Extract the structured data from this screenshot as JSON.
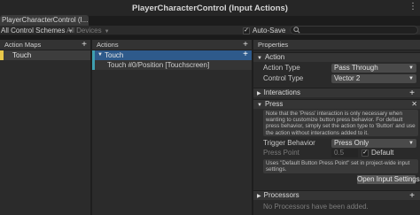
{
  "window": {
    "title": "PlayerCharacterControl (Input Actions)"
  },
  "tab": {
    "label": "PlayerCharacterControl (I..."
  },
  "toolbar": {
    "control_scheme": "All Control Schemes",
    "devices": "All Devices",
    "auto_save_label": "Auto-Save",
    "auto_save_checked": true,
    "search_placeholder": "",
    "search_icon": "search-icon"
  },
  "action_maps": {
    "header": "Action Maps",
    "items": [
      {
        "label": "Touch",
        "selected": true
      }
    ]
  },
  "actions": {
    "header": "Actions",
    "items": [
      {
        "label": "Touch",
        "selected": true,
        "expanded": true,
        "bindings": [
          {
            "label": "Touch #0/Position [Touchscreen]"
          }
        ]
      }
    ]
  },
  "properties": {
    "header": "Properties",
    "action_section": {
      "title": "Action",
      "action_type_label": "Action Type",
      "action_type_value": "Pass Through",
      "control_type_label": "Control Type",
      "control_type_value": "Vector 2"
    },
    "interactions_section": {
      "title": "Interactions"
    },
    "press_section": {
      "title": "Press",
      "note": "Note that the 'Press' interaction is only necessary when wanting to customize button press behavior. For default press behavior, simply set the action type to 'Button' and use the action without interactions added to it.",
      "trigger_behavior_label": "Trigger Behavior",
      "trigger_behavior_value": "Press Only",
      "press_point_label": "Press Point",
      "press_point_value": "0.5",
      "default_label": "Default",
      "default_checked": true,
      "default_note": "Uses \"Default Button Press Point\" set in project-wide input settings.",
      "open_settings_button": "Open Input Settings"
    },
    "processors_section": {
      "title": "Processors",
      "empty_text": "No Processors have been added."
    }
  },
  "colors": {
    "selected_action_bg": "#2e5a8b",
    "action_map_marker": "#e9c84a",
    "action_marker": "#3f9fb0"
  }
}
